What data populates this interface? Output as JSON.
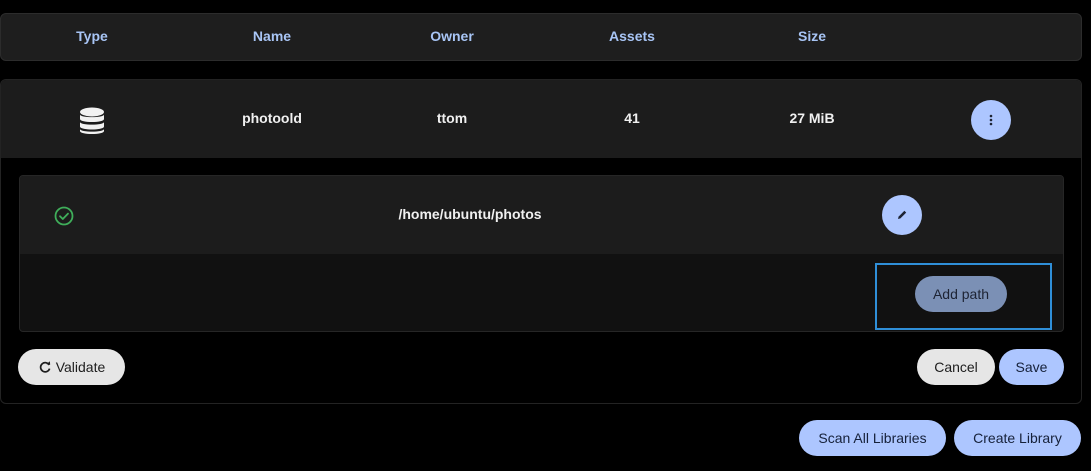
{
  "table_header": {
    "type": "Type",
    "name": "Name",
    "owner": "Owner",
    "assets": "Assets",
    "size": "Size"
  },
  "library": {
    "icon": "database-icon",
    "name": "photoold",
    "owner": "ttom",
    "assets": "41",
    "size": "27 MiB",
    "menu_icon": "more-vertical-icon"
  },
  "import_paths": {
    "items": [
      {
        "status_icon": "check-circle-icon",
        "path": "/home/ubuntu/photos",
        "edit_icon": "pencil-icon"
      }
    ],
    "add_path_label": "Add path"
  },
  "form_actions": {
    "validate_label": "Validate",
    "validate_icon": "refresh-icon",
    "cancel_label": "Cancel",
    "save_label": "Save"
  },
  "page_actions": {
    "scan_all_label": "Scan All Libraries",
    "create_label": "Create Library"
  },
  "colors": {
    "accent": "#adc6ff",
    "header_text": "#a8c5f5",
    "success": "#3fae5a",
    "focus_outline": "#2f8fd8"
  }
}
